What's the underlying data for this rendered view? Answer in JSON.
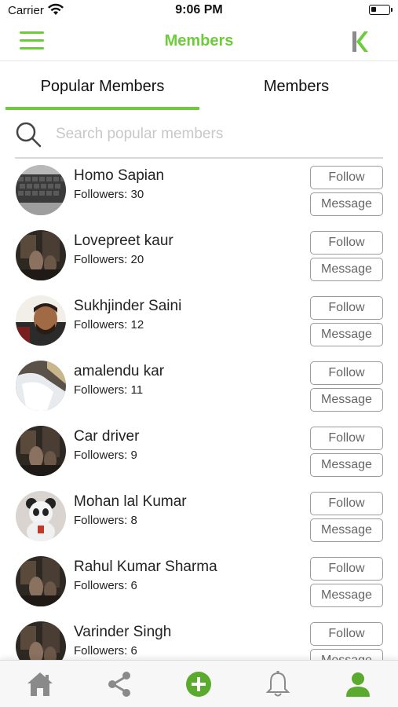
{
  "status_bar": {
    "carrier": "Carrier",
    "time": "9:06 PM"
  },
  "nav": {
    "title": "Members",
    "accent_color": "#6ccc3a"
  },
  "tabs": [
    {
      "label": "Popular Members",
      "active": true
    },
    {
      "label": "Members",
      "active": false
    }
  ],
  "search": {
    "placeholder": "Search popular members",
    "value": ""
  },
  "buttons": {
    "follow_label": "Follow",
    "message_label": "Message"
  },
  "members": [
    {
      "name": "Homo Sapian",
      "followers": "Followers: 30",
      "avatar": "keyboard-photo"
    },
    {
      "name": "Lovepreet kaur",
      "followers": "Followers: 20",
      "avatar": "dark-room-photo"
    },
    {
      "name": "Sukhjinder Saini",
      "followers": "Followers: 12",
      "avatar": "man-selfie-photo"
    },
    {
      "name": "amalendu kar",
      "followers": "Followers: 11",
      "avatar": "waterfall-photo"
    },
    {
      "name": "Car driver",
      "followers": "Followers: 9",
      "avatar": "dark-room-photo"
    },
    {
      "name": "Mohan lal Kumar",
      "followers": "Followers: 8",
      "avatar": "panda-toy-photo"
    },
    {
      "name": "Rahul Kumar Sharma",
      "followers": "Followers: 6",
      "avatar": "dark-room-photo"
    },
    {
      "name": "Varinder Singh",
      "followers": "Followers: 6",
      "avatar": "dark-room-photo"
    }
  ],
  "bottom_tabs": [
    {
      "icon": "home-icon",
      "active": false
    },
    {
      "icon": "share-icon",
      "active": false
    },
    {
      "icon": "add-icon",
      "active": false
    },
    {
      "icon": "bell-icon",
      "active": false
    },
    {
      "icon": "profile-icon",
      "active": true
    }
  ]
}
